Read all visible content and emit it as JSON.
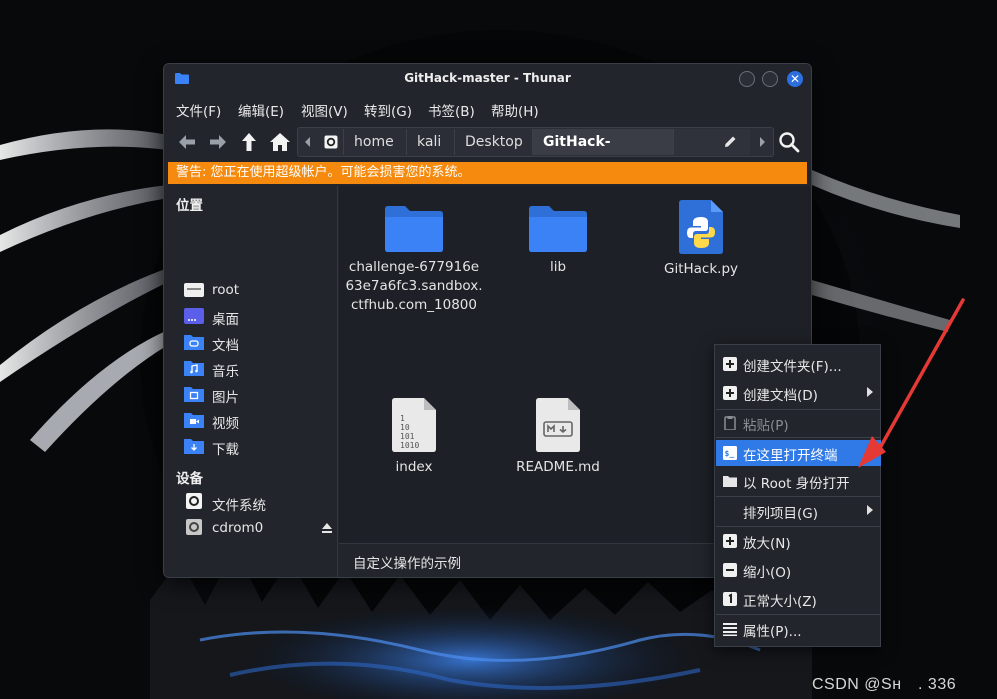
{
  "window": {
    "title": "GitHack-master - Thunar"
  },
  "menubar": {
    "items": [
      "文件(F)",
      "编辑(E)",
      "视图(V)",
      "转到(G)",
      "书签(B)",
      "帮助(H)"
    ]
  },
  "pathbar": {
    "crumbs": [
      "home",
      "kali",
      "Desktop",
      "GitHack-master"
    ]
  },
  "warning": "警告: 您正在使用超级帐户。可能会损害您的系统。",
  "sidebar": {
    "places_heading": "位置",
    "places": [
      {
        "label": "root",
        "icon": "drive-icon"
      },
      {
        "label": "桌面",
        "icon": "desktop-icon"
      },
      {
        "label": "文档",
        "icon": "documents-folder-icon"
      },
      {
        "label": "音乐",
        "icon": "music-folder-icon"
      },
      {
        "label": "图片",
        "icon": "pictures-folder-icon"
      },
      {
        "label": "视频",
        "icon": "videos-folder-icon"
      },
      {
        "label": "下载",
        "icon": "downloads-folder-icon"
      }
    ],
    "devices_heading": "设备",
    "devices": [
      {
        "label": "文件系统",
        "icon": "filesystem-icon"
      },
      {
        "label": "cdrom0",
        "icon": "cdrom-icon"
      }
    ]
  },
  "files": [
    {
      "name": "challenge-677916e63e7a6fc3.sandbox.ctfhub.com_10800",
      "lines": [
        "challenge-677916e",
        "63e7a6fc3.sandbox.",
        "ctfhub.com_10800"
      ],
      "icon": "folder-icon"
    },
    {
      "name": "lib",
      "lines": [
        "lib"
      ],
      "icon": "folder-icon"
    },
    {
      "name": "GitHack.py",
      "lines": [
        "GitHack.py"
      ],
      "icon": "python-file-icon"
    },
    {
      "name": "index",
      "lines": [
        "index"
      ],
      "icon": "binary-file-icon"
    },
    {
      "name": "README.md",
      "lines": [
        "README.md"
      ],
      "icon": "markdown-file-icon"
    }
  ],
  "status": "自定义操作的示例",
  "context_menu": {
    "items": [
      {
        "label": "创建文件夹(F)...",
        "icon": "new-folder-icon"
      },
      {
        "label": "创建文档(D)",
        "icon": "new-document-icon"
      },
      {
        "label": "粘贴(P)",
        "icon": "paste-icon"
      },
      {
        "label": "在这里打开终端",
        "icon": "terminal-icon"
      },
      {
        "label": "以 Root 身份打开",
        "icon": "folder-icon"
      },
      {
        "label": "排列项目(G)",
        "icon": ""
      },
      {
        "label": "放大(N)",
        "icon": "zoom-in-icon"
      },
      {
        "label": "缩小(O)",
        "icon": "zoom-out-icon"
      },
      {
        "label": "正常大小(Z)",
        "icon": "zoom-reset-icon"
      },
      {
        "label": "属性(P)...",
        "icon": "properties-icon"
      }
    ]
  },
  "watermark": "CSDN @Sн　. 336",
  "colors": {
    "accent": "#2f7ae6",
    "warning": "#f58a0f",
    "folder": "#3b82f6",
    "annotation": "#e53935"
  }
}
